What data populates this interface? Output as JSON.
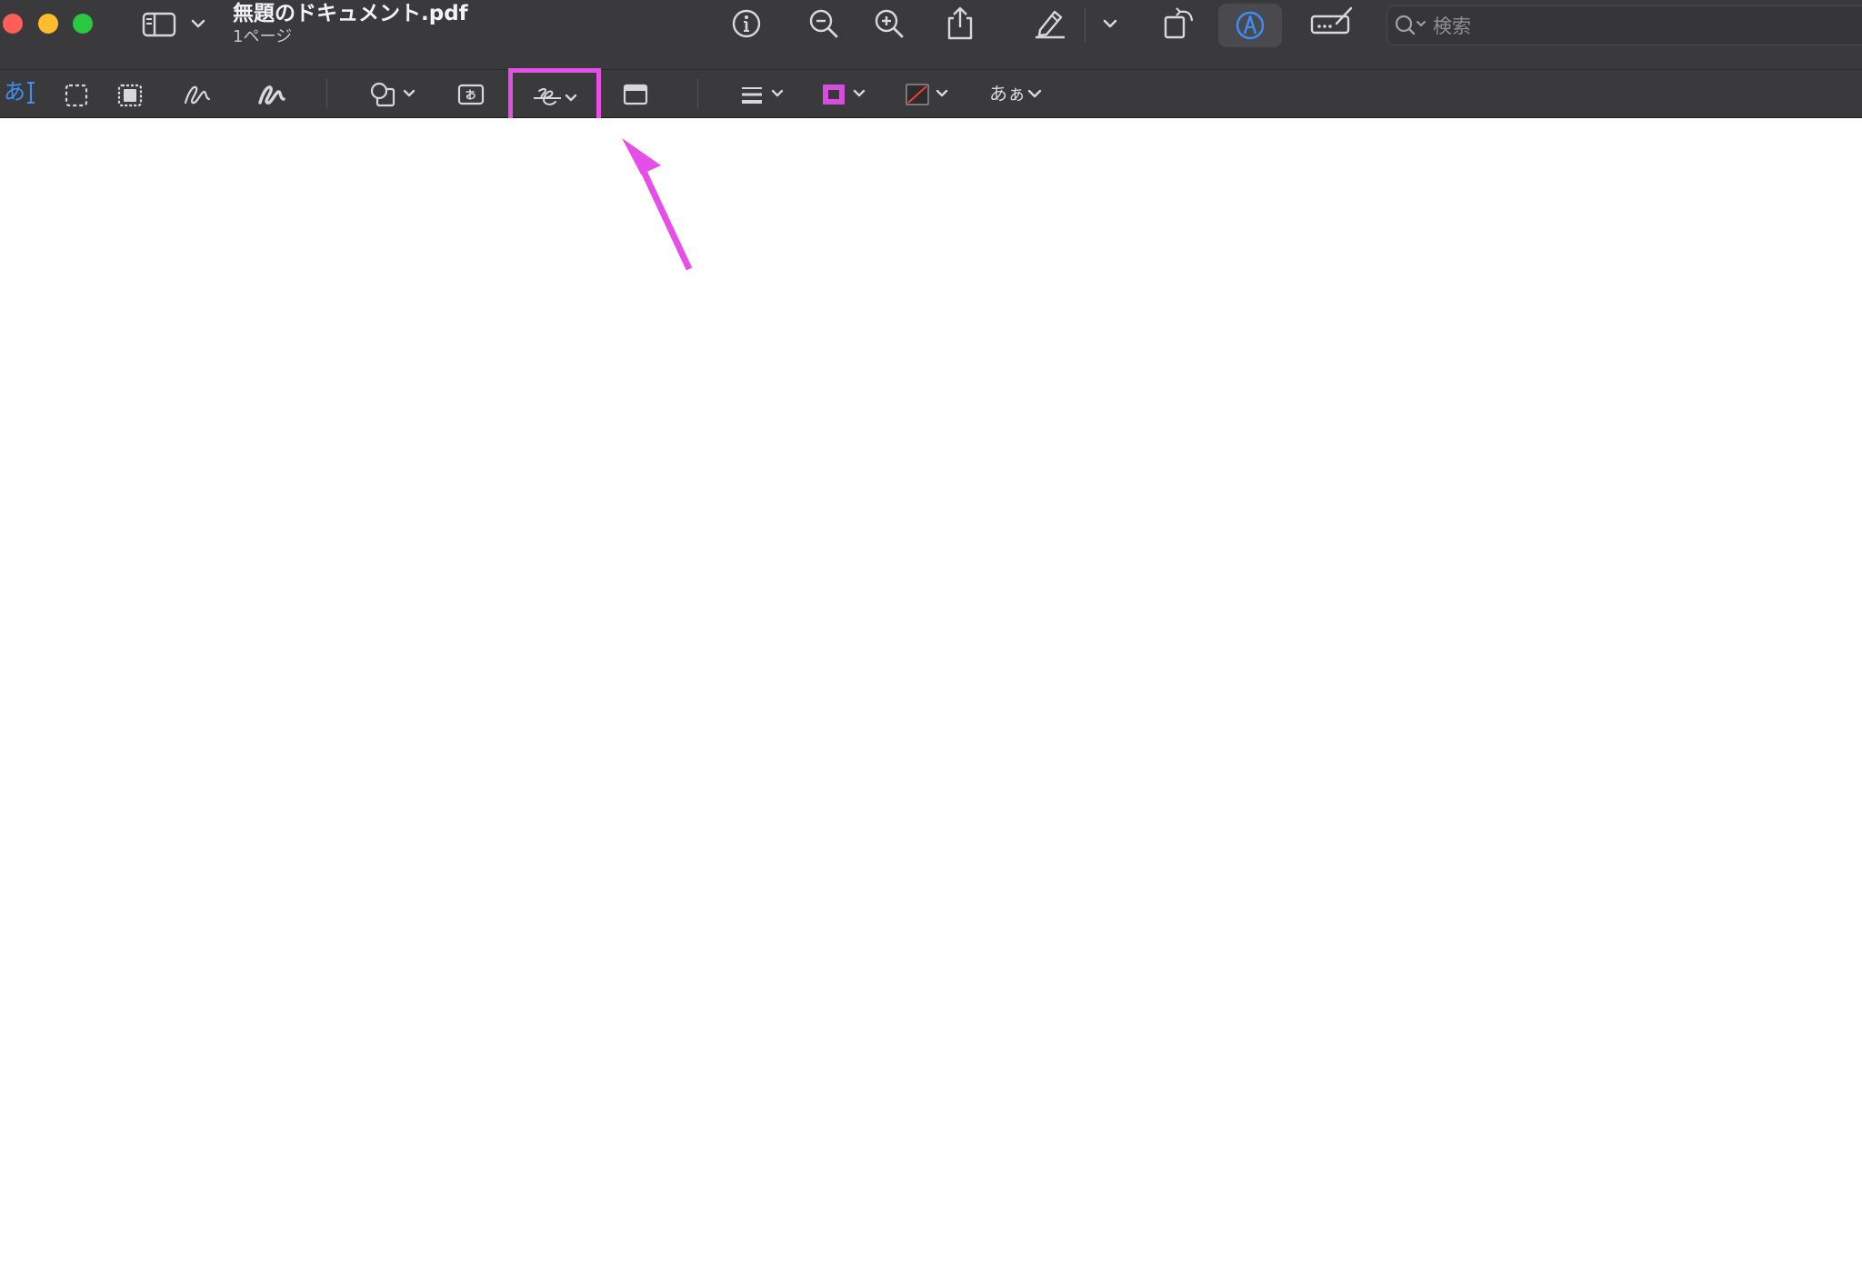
{
  "window": {
    "title": "無題のドキュメント.pdf",
    "subtitle": "1ページ"
  },
  "search": {
    "placeholder": "検索"
  },
  "markup_toolbar": {
    "text_selection_label": "あ",
    "font_button_label": "あぁ"
  },
  "annotation": {
    "highlight_color": "#e64ee8",
    "target": "sign-tool-button"
  },
  "colors": {
    "toolbar_bg": "#3a3a3c",
    "close": "#ff5f57",
    "minimize": "#febc2e",
    "zoom": "#28c840",
    "accent_blue": "#3d8ef7",
    "border_color_swatch": "#d84ce0",
    "fill_color_swatch_slash": "#ff3b30"
  }
}
